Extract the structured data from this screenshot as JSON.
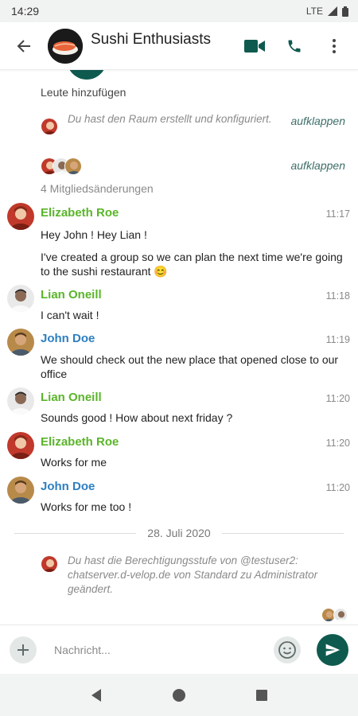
{
  "status_bar": {
    "time": "14:29",
    "network": "LTE"
  },
  "header": {
    "room_name": "Sushi Enthusiasts"
  },
  "timeline": {
    "add_people": "Leute hinzufügen",
    "created_note": "Du hast den Raum erstellt und konfiguriert.",
    "expand_1": "aufklappen",
    "expand_2": "aufklappen",
    "member_changes": "4 Mitgliedsänderungen",
    "messages": [
      {
        "sender": "Elizabeth Roe",
        "time": "11:17",
        "lines": [
          "Hey John ! Hey Lian !",
          "I've created a group so we can plan the next time we're going to the sushi restaurant 😊"
        ]
      },
      {
        "sender": "Lian Oneill",
        "time": "11:18",
        "lines": [
          "I can't wait !"
        ]
      },
      {
        "sender": "John Doe",
        "time": "11:19",
        "lines": [
          "We should check out the new place that opened close to our office"
        ]
      },
      {
        "sender": "Lian Oneill",
        "time": "11:20",
        "lines": [
          "Sounds good ! How about next friday ?"
        ]
      },
      {
        "sender": "Elizabeth Roe",
        "time": "11:20",
        "lines": [
          "Works for me"
        ]
      },
      {
        "sender": "John Doe",
        "time": "11:20",
        "lines": [
          "Works for me too !"
        ]
      }
    ],
    "date_separator": "28. Juli 2020",
    "permission_note": "Du hast die Berechtigungsstufe von @testuser2: chatserver.d-velop.de von Standard zu Administrator geändert."
  },
  "composer": {
    "placeholder": "Nachricht..."
  },
  "colors": {
    "accent": "#0f5a4f",
    "elizabeth": "#5ab52a",
    "lian": "#5ab52a",
    "john": "#2d7fc1"
  }
}
